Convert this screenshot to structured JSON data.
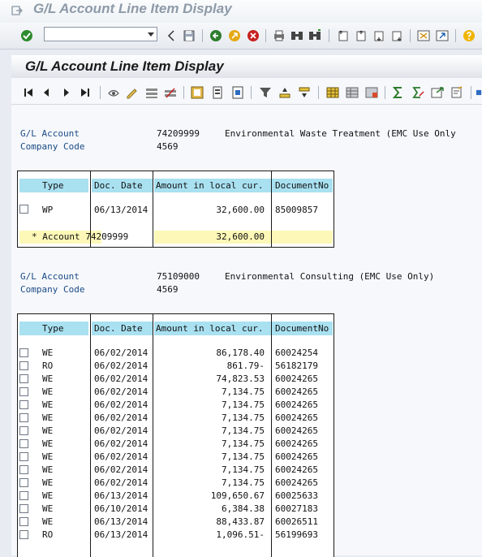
{
  "window": {
    "title": "G/L Account Line Item Display"
  },
  "system_toolbar": {
    "command_field": {
      "value": ""
    },
    "icons": [
      "enter-icon",
      "save-icon",
      "back-icon",
      "exit-icon",
      "cancel-icon",
      "print-icon",
      "find-icon",
      "find-next-icon",
      "first-page-icon",
      "previous-page-icon",
      "next-page-icon",
      "last-page-icon",
      "create-session-icon",
      "shortcut-icon",
      "help-icon"
    ]
  },
  "page": {
    "title": "G/L Account Line Item Display"
  },
  "app_toolbar": {
    "icons": [
      "first-item-icon",
      "previous-item-icon",
      "next-item-icon",
      "last-item-icon",
      "display-document-icon",
      "change-document-icon",
      "select-all-icon",
      "deselect-all-icon",
      "document-header-icon",
      "choose-details-icon",
      "save-selection-icon",
      "set-filter-icon",
      "sort-ascending-icon",
      "sort-descending-icon",
      "layout-icon",
      "change-layout-icon",
      "save-layout-icon",
      "total-icon",
      "subtotal-icon",
      "export-icon",
      "print-preview-icon"
    ]
  },
  "blocks": [
    {
      "labels": {
        "account": "G/L Account",
        "company": "Company Code"
      },
      "account_no": "74209999",
      "account_name": "Environmental Waste Treatment (EMC Use Only",
      "company_code": "4569",
      "columns": [
        "Type",
        "Doc. Date",
        "Amount in local cur.",
        "DocumentNo"
      ],
      "rows": [
        {
          "type": "WP",
          "date": "06/13/2014",
          "amount": "32,600.00",
          "doc": "85009857"
        }
      ],
      "total": {
        "label": "* Account 74209999",
        "amount": "32,600.00"
      }
    },
    {
      "labels": {
        "account": "G/L Account",
        "company": "Company Code"
      },
      "account_no": "75109000",
      "account_name": "Environmental Consulting (EMC Use Only)",
      "company_code": "4569",
      "columns": [
        "Type",
        "Doc. Date",
        "Amount in local cur.",
        "DocumentNo"
      ],
      "rows": [
        {
          "type": "WE",
          "date": "06/02/2014",
          "amount": "86,178.40",
          "doc": "60024254"
        },
        {
          "type": "RO",
          "date": "06/02/2014",
          "amount": "861.79-",
          "doc": "56182179"
        },
        {
          "type": "WE",
          "date": "06/02/2014",
          "amount": "74,823.53",
          "doc": "60024265"
        },
        {
          "type": "WE",
          "date": "06/02/2014",
          "amount": "7,134.75",
          "doc": "60024265"
        },
        {
          "type": "WE",
          "date": "06/02/2014",
          "amount": "7,134.75",
          "doc": "60024265"
        },
        {
          "type": "WE",
          "date": "06/02/2014",
          "amount": "7,134.75",
          "doc": "60024265"
        },
        {
          "type": "WE",
          "date": "06/02/2014",
          "amount": "7,134.75",
          "doc": "60024265"
        },
        {
          "type": "WE",
          "date": "06/02/2014",
          "amount": "7,134.75",
          "doc": "60024265"
        },
        {
          "type": "WE",
          "date": "06/02/2014",
          "amount": "7,134.75",
          "doc": "60024265"
        },
        {
          "type": "WE",
          "date": "06/02/2014",
          "amount": "7,134.75",
          "doc": "60024265"
        },
        {
          "type": "WE",
          "date": "06/02/2014",
          "amount": "7,134.75",
          "doc": "60024265"
        },
        {
          "type": "WE",
          "date": "06/13/2014",
          "amount": "109,650.67",
          "doc": "60025633"
        },
        {
          "type": "WE",
          "date": "06/10/2014",
          "amount": "6,384.38",
          "doc": "60027183"
        },
        {
          "type": "WE",
          "date": "06/13/2014",
          "amount": "88,433.87",
          "doc": "60026511"
        },
        {
          "type": "RO",
          "date": "06/13/2014",
          "amount": "1,096.51-",
          "doc": "56199693"
        }
      ]
    }
  ]
}
